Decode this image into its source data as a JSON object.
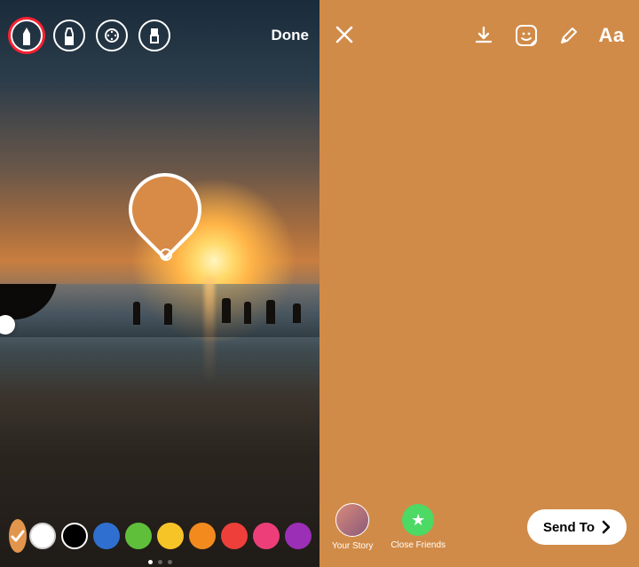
{
  "left": {
    "toolbar": {
      "pen_tool": "pen-marker",
      "highlighter_tool": "chisel-marker",
      "neon_tool": "neon-brush",
      "eraser_tool": "eraser",
      "done_label": "Done",
      "selected_index": 0
    },
    "eyedropper_color": "#d88b47",
    "color_swatches": [
      {
        "name": "eyedropper",
        "color": "#e2954d",
        "icon": "check"
      },
      {
        "name": "white",
        "color": "#ffffff",
        "border": "#d0d0d0"
      },
      {
        "name": "black",
        "color": "#000000",
        "border": "#ffffff"
      },
      {
        "name": "blue",
        "color": "#2f6fd0"
      },
      {
        "name": "green",
        "color": "#5fbf3a"
      },
      {
        "name": "yellow",
        "color": "#f7c427"
      },
      {
        "name": "orange",
        "color": "#f28a1e"
      },
      {
        "name": "red",
        "color": "#ee3f3a"
      },
      {
        "name": "pink",
        "color": "#ed3e7a"
      },
      {
        "name": "purple",
        "color": "#9b2fb5"
      }
    ],
    "pager_total": 3,
    "pager_active": 0
  },
  "right": {
    "bg_color": "#d18b48",
    "toolbar": {
      "close": "close",
      "save": "download",
      "stickers": "sticker-smile",
      "draw": "draw-pen",
      "text_label": "Aa"
    },
    "share": {
      "your_story_label": "Your Story",
      "close_friends_label": "Close Friends",
      "send_to_label": "Send To"
    }
  }
}
